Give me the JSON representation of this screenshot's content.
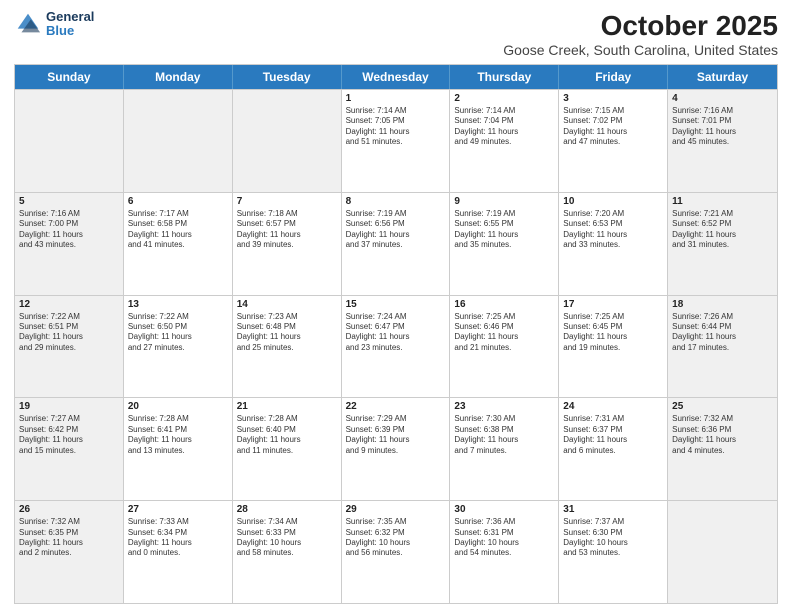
{
  "header": {
    "logo_line1": "General",
    "logo_line2": "Blue",
    "title": "October 2025",
    "subtitle": "Goose Creek, South Carolina, United States"
  },
  "days_of_week": [
    "Sunday",
    "Monday",
    "Tuesday",
    "Wednesday",
    "Thursday",
    "Friday",
    "Saturday"
  ],
  "weeks": [
    [
      {
        "day": "",
        "info": "",
        "shaded": true
      },
      {
        "day": "",
        "info": "",
        "shaded": true
      },
      {
        "day": "",
        "info": "",
        "shaded": true
      },
      {
        "day": "1",
        "info": "Sunrise: 7:14 AM\nSunset: 7:05 PM\nDaylight: 11 hours\nand 51 minutes.",
        "shaded": false
      },
      {
        "day": "2",
        "info": "Sunrise: 7:14 AM\nSunset: 7:04 PM\nDaylight: 11 hours\nand 49 minutes.",
        "shaded": false
      },
      {
        "day": "3",
        "info": "Sunrise: 7:15 AM\nSunset: 7:02 PM\nDaylight: 11 hours\nand 47 minutes.",
        "shaded": false
      },
      {
        "day": "4",
        "info": "Sunrise: 7:16 AM\nSunset: 7:01 PM\nDaylight: 11 hours\nand 45 minutes.",
        "shaded": true
      }
    ],
    [
      {
        "day": "5",
        "info": "Sunrise: 7:16 AM\nSunset: 7:00 PM\nDaylight: 11 hours\nand 43 minutes.",
        "shaded": true
      },
      {
        "day": "6",
        "info": "Sunrise: 7:17 AM\nSunset: 6:58 PM\nDaylight: 11 hours\nand 41 minutes.",
        "shaded": false
      },
      {
        "day": "7",
        "info": "Sunrise: 7:18 AM\nSunset: 6:57 PM\nDaylight: 11 hours\nand 39 minutes.",
        "shaded": false
      },
      {
        "day": "8",
        "info": "Sunrise: 7:19 AM\nSunset: 6:56 PM\nDaylight: 11 hours\nand 37 minutes.",
        "shaded": false
      },
      {
        "day": "9",
        "info": "Sunrise: 7:19 AM\nSunset: 6:55 PM\nDaylight: 11 hours\nand 35 minutes.",
        "shaded": false
      },
      {
        "day": "10",
        "info": "Sunrise: 7:20 AM\nSunset: 6:53 PM\nDaylight: 11 hours\nand 33 minutes.",
        "shaded": false
      },
      {
        "day": "11",
        "info": "Sunrise: 7:21 AM\nSunset: 6:52 PM\nDaylight: 11 hours\nand 31 minutes.",
        "shaded": true
      }
    ],
    [
      {
        "day": "12",
        "info": "Sunrise: 7:22 AM\nSunset: 6:51 PM\nDaylight: 11 hours\nand 29 minutes.",
        "shaded": true
      },
      {
        "day": "13",
        "info": "Sunrise: 7:22 AM\nSunset: 6:50 PM\nDaylight: 11 hours\nand 27 minutes.",
        "shaded": false
      },
      {
        "day": "14",
        "info": "Sunrise: 7:23 AM\nSunset: 6:48 PM\nDaylight: 11 hours\nand 25 minutes.",
        "shaded": false
      },
      {
        "day": "15",
        "info": "Sunrise: 7:24 AM\nSunset: 6:47 PM\nDaylight: 11 hours\nand 23 minutes.",
        "shaded": false
      },
      {
        "day": "16",
        "info": "Sunrise: 7:25 AM\nSunset: 6:46 PM\nDaylight: 11 hours\nand 21 minutes.",
        "shaded": false
      },
      {
        "day": "17",
        "info": "Sunrise: 7:25 AM\nSunset: 6:45 PM\nDaylight: 11 hours\nand 19 minutes.",
        "shaded": false
      },
      {
        "day": "18",
        "info": "Sunrise: 7:26 AM\nSunset: 6:44 PM\nDaylight: 11 hours\nand 17 minutes.",
        "shaded": true
      }
    ],
    [
      {
        "day": "19",
        "info": "Sunrise: 7:27 AM\nSunset: 6:42 PM\nDaylight: 11 hours\nand 15 minutes.",
        "shaded": true
      },
      {
        "day": "20",
        "info": "Sunrise: 7:28 AM\nSunset: 6:41 PM\nDaylight: 11 hours\nand 13 minutes.",
        "shaded": false
      },
      {
        "day": "21",
        "info": "Sunrise: 7:28 AM\nSunset: 6:40 PM\nDaylight: 11 hours\nand 11 minutes.",
        "shaded": false
      },
      {
        "day": "22",
        "info": "Sunrise: 7:29 AM\nSunset: 6:39 PM\nDaylight: 11 hours\nand 9 minutes.",
        "shaded": false
      },
      {
        "day": "23",
        "info": "Sunrise: 7:30 AM\nSunset: 6:38 PM\nDaylight: 11 hours\nand 7 minutes.",
        "shaded": false
      },
      {
        "day": "24",
        "info": "Sunrise: 7:31 AM\nSunset: 6:37 PM\nDaylight: 11 hours\nand 6 minutes.",
        "shaded": false
      },
      {
        "day": "25",
        "info": "Sunrise: 7:32 AM\nSunset: 6:36 PM\nDaylight: 11 hours\nand 4 minutes.",
        "shaded": true
      }
    ],
    [
      {
        "day": "26",
        "info": "Sunrise: 7:32 AM\nSunset: 6:35 PM\nDaylight: 11 hours\nand 2 minutes.",
        "shaded": true
      },
      {
        "day": "27",
        "info": "Sunrise: 7:33 AM\nSunset: 6:34 PM\nDaylight: 11 hours\nand 0 minutes.",
        "shaded": false
      },
      {
        "day": "28",
        "info": "Sunrise: 7:34 AM\nSunset: 6:33 PM\nDaylight: 10 hours\nand 58 minutes.",
        "shaded": false
      },
      {
        "day": "29",
        "info": "Sunrise: 7:35 AM\nSunset: 6:32 PM\nDaylight: 10 hours\nand 56 minutes.",
        "shaded": false
      },
      {
        "day": "30",
        "info": "Sunrise: 7:36 AM\nSunset: 6:31 PM\nDaylight: 10 hours\nand 54 minutes.",
        "shaded": false
      },
      {
        "day": "31",
        "info": "Sunrise: 7:37 AM\nSunset: 6:30 PM\nDaylight: 10 hours\nand 53 minutes.",
        "shaded": false
      },
      {
        "day": "",
        "info": "",
        "shaded": true
      }
    ]
  ]
}
